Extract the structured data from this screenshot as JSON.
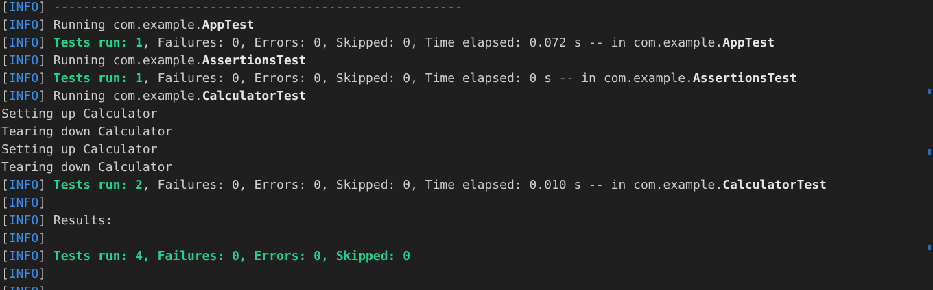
{
  "terminal": {
    "lines": [
      {
        "segments": [
          {
            "t": "[",
            "c": "bracket"
          },
          {
            "t": "INFO",
            "c": "info"
          },
          {
            "t": "] ",
            "c": "bracket"
          },
          {
            "t": "-------------------------------------------------------",
            "c": "plain"
          }
        ]
      },
      {
        "segments": [
          {
            "t": "[",
            "c": "bracket"
          },
          {
            "t": "INFO",
            "c": "info"
          },
          {
            "t": "] ",
            "c": "bracket"
          },
          {
            "t": "Running com.example.",
            "c": "plain"
          },
          {
            "t": "AppTest",
            "c": "bold"
          }
        ]
      },
      {
        "segments": [
          {
            "t": "[",
            "c": "bracket"
          },
          {
            "t": "INFO",
            "c": "info"
          },
          {
            "t": "] ",
            "c": "bracket"
          },
          {
            "t": "Tests run: 1",
            "c": "green"
          },
          {
            "t": ", Failures: 0, Errors: 0, Skipped: 0, Time elapsed: 0.072 s -- in com.example.",
            "c": "plain"
          },
          {
            "t": "AppTest",
            "c": "bold"
          }
        ]
      },
      {
        "segments": [
          {
            "t": "[",
            "c": "bracket"
          },
          {
            "t": "INFO",
            "c": "info"
          },
          {
            "t": "] ",
            "c": "bracket"
          },
          {
            "t": "Running com.example.",
            "c": "plain"
          },
          {
            "t": "AssertionsTest",
            "c": "bold"
          }
        ]
      },
      {
        "segments": [
          {
            "t": "[",
            "c": "bracket"
          },
          {
            "t": "INFO",
            "c": "info"
          },
          {
            "t": "] ",
            "c": "bracket"
          },
          {
            "t": "Tests run: 1",
            "c": "green"
          },
          {
            "t": ", Failures: 0, Errors: 0, Skipped: 0, Time elapsed: 0 s -- in com.example.",
            "c": "plain"
          },
          {
            "t": "AssertionsTest",
            "c": "bold"
          }
        ]
      },
      {
        "segments": [
          {
            "t": "[",
            "c": "bracket"
          },
          {
            "t": "INFO",
            "c": "info"
          },
          {
            "t": "] ",
            "c": "bracket"
          },
          {
            "t": "Running com.example.",
            "c": "plain"
          },
          {
            "t": "CalculatorTest",
            "c": "bold"
          }
        ]
      },
      {
        "segments": [
          {
            "t": "Setting up Calculator",
            "c": "plain"
          }
        ]
      },
      {
        "segments": [
          {
            "t": "Tearing down Calculator",
            "c": "plain"
          }
        ]
      },
      {
        "segments": [
          {
            "t": "Setting up Calculator",
            "c": "plain"
          }
        ]
      },
      {
        "segments": [
          {
            "t": "Tearing down Calculator",
            "c": "plain"
          }
        ]
      },
      {
        "segments": [
          {
            "t": "[",
            "c": "bracket"
          },
          {
            "t": "INFO",
            "c": "info"
          },
          {
            "t": "] ",
            "c": "bracket"
          },
          {
            "t": "Tests run: 2",
            "c": "green"
          },
          {
            "t": ", Failures: 0, Errors: 0, Skipped: 0, Time elapsed: 0.010 s -- in com.example.",
            "c": "plain"
          },
          {
            "t": "CalculatorTest",
            "c": "bold"
          }
        ]
      },
      {
        "segments": [
          {
            "t": "[",
            "c": "bracket"
          },
          {
            "t": "INFO",
            "c": "info"
          },
          {
            "t": "]",
            "c": "bracket"
          }
        ]
      },
      {
        "segments": [
          {
            "t": "[",
            "c": "bracket"
          },
          {
            "t": "INFO",
            "c": "info"
          },
          {
            "t": "] ",
            "c": "bracket"
          },
          {
            "t": "Results:",
            "c": "plain"
          }
        ]
      },
      {
        "segments": [
          {
            "t": "[",
            "c": "bracket"
          },
          {
            "t": "INFO",
            "c": "info"
          },
          {
            "t": "]",
            "c": "bracket"
          }
        ]
      },
      {
        "segments": [
          {
            "t": "[",
            "c": "bracket"
          },
          {
            "t": "INFO",
            "c": "info"
          },
          {
            "t": "] ",
            "c": "bracket"
          },
          {
            "t": "Tests run: 4, Failures: 0, Errors: 0, Skipped: 0",
            "c": "green"
          }
        ]
      },
      {
        "segments": [
          {
            "t": "[",
            "c": "bracket"
          },
          {
            "t": "INFO",
            "c": "info"
          },
          {
            "t": "]",
            "c": "bracket"
          }
        ]
      },
      {
        "segments": [
          {
            "t": "[",
            "c": "bracket"
          },
          {
            "t": "INFO",
            "c": "info"
          },
          {
            "t": "]",
            "c": "bracket"
          }
        ]
      }
    ]
  },
  "colors": {
    "background": "#1f1f1f",
    "info": "#3b8eea",
    "success": "#23d18b",
    "text": "#cccccc",
    "scroll_marker": "#1f6bbd"
  }
}
